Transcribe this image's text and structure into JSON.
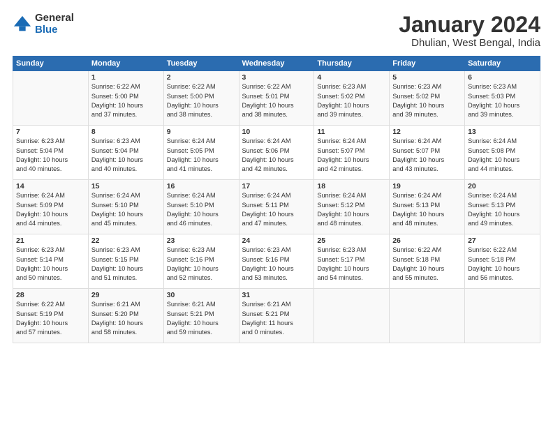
{
  "logo": {
    "general": "General",
    "blue": "Blue"
  },
  "title": "January 2024",
  "location": "Dhulian, West Bengal, India",
  "days_header": [
    "Sunday",
    "Monday",
    "Tuesday",
    "Wednesday",
    "Thursday",
    "Friday",
    "Saturday"
  ],
  "weeks": [
    [
      {
        "num": "",
        "info": ""
      },
      {
        "num": "1",
        "info": "Sunrise: 6:22 AM\nSunset: 5:00 PM\nDaylight: 10 hours\nand 37 minutes."
      },
      {
        "num": "2",
        "info": "Sunrise: 6:22 AM\nSunset: 5:00 PM\nDaylight: 10 hours\nand 38 minutes."
      },
      {
        "num": "3",
        "info": "Sunrise: 6:22 AM\nSunset: 5:01 PM\nDaylight: 10 hours\nand 38 minutes."
      },
      {
        "num": "4",
        "info": "Sunrise: 6:23 AM\nSunset: 5:02 PM\nDaylight: 10 hours\nand 39 minutes."
      },
      {
        "num": "5",
        "info": "Sunrise: 6:23 AM\nSunset: 5:02 PM\nDaylight: 10 hours\nand 39 minutes."
      },
      {
        "num": "6",
        "info": "Sunrise: 6:23 AM\nSunset: 5:03 PM\nDaylight: 10 hours\nand 39 minutes."
      }
    ],
    [
      {
        "num": "7",
        "info": "Sunrise: 6:23 AM\nSunset: 5:04 PM\nDaylight: 10 hours\nand 40 minutes."
      },
      {
        "num": "8",
        "info": "Sunrise: 6:23 AM\nSunset: 5:04 PM\nDaylight: 10 hours\nand 40 minutes."
      },
      {
        "num": "9",
        "info": "Sunrise: 6:24 AM\nSunset: 5:05 PM\nDaylight: 10 hours\nand 41 minutes."
      },
      {
        "num": "10",
        "info": "Sunrise: 6:24 AM\nSunset: 5:06 PM\nDaylight: 10 hours\nand 42 minutes."
      },
      {
        "num": "11",
        "info": "Sunrise: 6:24 AM\nSunset: 5:07 PM\nDaylight: 10 hours\nand 42 minutes."
      },
      {
        "num": "12",
        "info": "Sunrise: 6:24 AM\nSunset: 5:07 PM\nDaylight: 10 hours\nand 43 minutes."
      },
      {
        "num": "13",
        "info": "Sunrise: 6:24 AM\nSunset: 5:08 PM\nDaylight: 10 hours\nand 44 minutes."
      }
    ],
    [
      {
        "num": "14",
        "info": "Sunrise: 6:24 AM\nSunset: 5:09 PM\nDaylight: 10 hours\nand 44 minutes."
      },
      {
        "num": "15",
        "info": "Sunrise: 6:24 AM\nSunset: 5:10 PM\nDaylight: 10 hours\nand 45 minutes."
      },
      {
        "num": "16",
        "info": "Sunrise: 6:24 AM\nSunset: 5:10 PM\nDaylight: 10 hours\nand 46 minutes."
      },
      {
        "num": "17",
        "info": "Sunrise: 6:24 AM\nSunset: 5:11 PM\nDaylight: 10 hours\nand 47 minutes."
      },
      {
        "num": "18",
        "info": "Sunrise: 6:24 AM\nSunset: 5:12 PM\nDaylight: 10 hours\nand 48 minutes."
      },
      {
        "num": "19",
        "info": "Sunrise: 6:24 AM\nSunset: 5:13 PM\nDaylight: 10 hours\nand 48 minutes."
      },
      {
        "num": "20",
        "info": "Sunrise: 6:24 AM\nSunset: 5:13 PM\nDaylight: 10 hours\nand 49 minutes."
      }
    ],
    [
      {
        "num": "21",
        "info": "Sunrise: 6:23 AM\nSunset: 5:14 PM\nDaylight: 10 hours\nand 50 minutes."
      },
      {
        "num": "22",
        "info": "Sunrise: 6:23 AM\nSunset: 5:15 PM\nDaylight: 10 hours\nand 51 minutes."
      },
      {
        "num": "23",
        "info": "Sunrise: 6:23 AM\nSunset: 5:16 PM\nDaylight: 10 hours\nand 52 minutes."
      },
      {
        "num": "24",
        "info": "Sunrise: 6:23 AM\nSunset: 5:16 PM\nDaylight: 10 hours\nand 53 minutes."
      },
      {
        "num": "25",
        "info": "Sunrise: 6:23 AM\nSunset: 5:17 PM\nDaylight: 10 hours\nand 54 minutes."
      },
      {
        "num": "26",
        "info": "Sunrise: 6:22 AM\nSunset: 5:18 PM\nDaylight: 10 hours\nand 55 minutes."
      },
      {
        "num": "27",
        "info": "Sunrise: 6:22 AM\nSunset: 5:18 PM\nDaylight: 10 hours\nand 56 minutes."
      }
    ],
    [
      {
        "num": "28",
        "info": "Sunrise: 6:22 AM\nSunset: 5:19 PM\nDaylight: 10 hours\nand 57 minutes."
      },
      {
        "num": "29",
        "info": "Sunrise: 6:21 AM\nSunset: 5:20 PM\nDaylight: 10 hours\nand 58 minutes."
      },
      {
        "num": "30",
        "info": "Sunrise: 6:21 AM\nSunset: 5:21 PM\nDaylight: 10 hours\nand 59 minutes."
      },
      {
        "num": "31",
        "info": "Sunrise: 6:21 AM\nSunset: 5:21 PM\nDaylight: 11 hours\nand 0 minutes."
      },
      {
        "num": "",
        "info": ""
      },
      {
        "num": "",
        "info": ""
      },
      {
        "num": "",
        "info": ""
      }
    ]
  ]
}
